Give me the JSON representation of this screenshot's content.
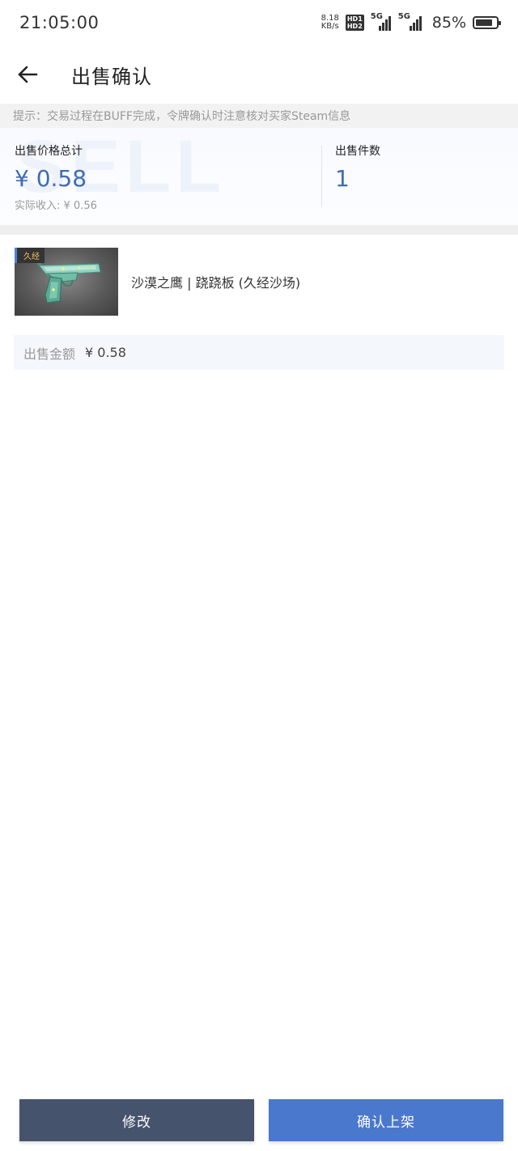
{
  "status_bar": {
    "time": "21:05:00",
    "net_speed_value": "8.18",
    "net_speed_unit": "KB/s",
    "hd_badge_top": "HD1",
    "hd_badge_bottom": "HD2",
    "signal1_label": "5G",
    "signal2_label": "5G",
    "battery_percent": "85%",
    "battery_level": 0.85
  },
  "header": {
    "title": "出售确认"
  },
  "hint": {
    "text": "提示：交易过程在BUFF完成，令牌确认时注意核对买家Steam信息"
  },
  "summary": {
    "watermark": "SELL",
    "total_price_label": "出售价格总计",
    "total_price_value": "¥ 0.58",
    "actual_income": "实际收入: ¥ 0.56",
    "count_label": "出售件数",
    "count_value": "1"
  },
  "item": {
    "wear_tag": "久经",
    "name": "沙漠之鹰 | 跷跷板 (久经沙场)"
  },
  "price_row": {
    "label": "出售金额",
    "value": "¥ 0.58"
  },
  "actions": {
    "modify_label": "修改",
    "confirm_label": "确认上架"
  },
  "colors": {
    "accent_blue": "#4a78cc",
    "price_blue": "#3f6cb5",
    "modify_dark": "#46536d"
  }
}
